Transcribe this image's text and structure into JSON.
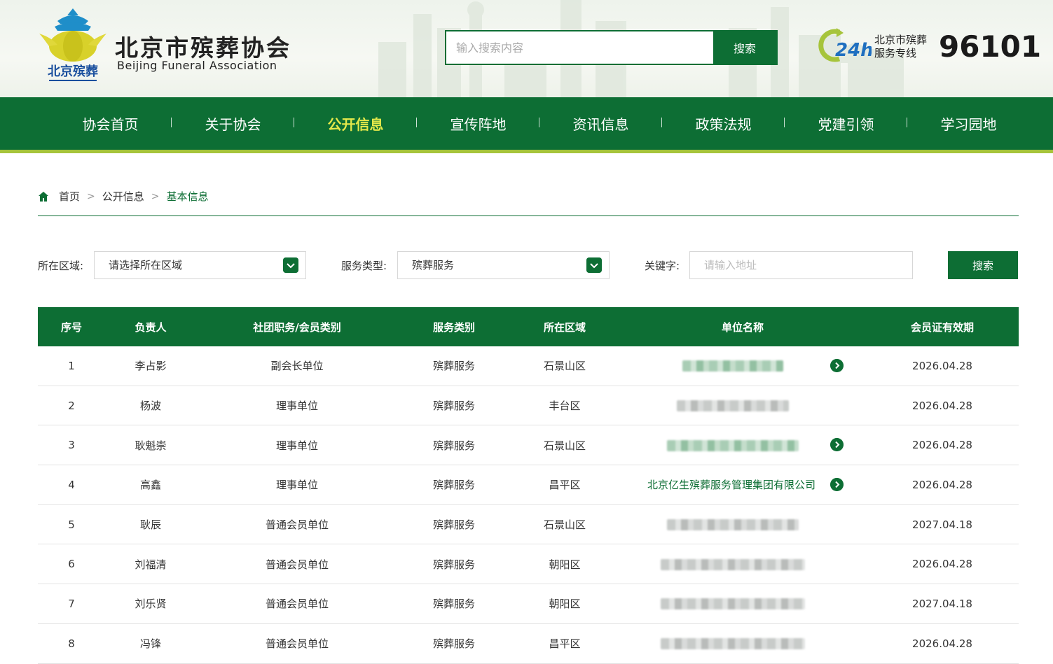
{
  "header": {
    "logo_cn": "北京市殡葬协会",
    "logo_en": "Beijing Funeral Association",
    "search": {
      "placeholder": "输入搜索内容",
      "button": "搜索"
    },
    "hotline": {
      "line1": "北京市殡葬",
      "line2": "服务专线",
      "number": "96101",
      "icon_text": "24h"
    }
  },
  "nav": {
    "items": [
      "协会首页",
      "关于协会",
      "公开信息",
      "宣传阵地",
      "资讯信息",
      "政策法规",
      "党建引领",
      "学习园地"
    ],
    "active_index": 2
  },
  "breadcrumb": {
    "home": "首页",
    "section": "公开信息",
    "current": "基本信息"
  },
  "filters": {
    "region_label": "所在区域:",
    "region_value": "请选择所在区域",
    "type_label": "服务类型:",
    "type_value": "殡葬服务",
    "keyword_label": "关键字:",
    "keyword_placeholder": "请输入地址",
    "button": "搜索"
  },
  "table": {
    "headers": [
      "序号",
      "负责人",
      "社团职务/会员类别",
      "服务类别",
      "所在区域",
      "单位名称",
      "会员证有效期"
    ],
    "rows": [
      {
        "no": "1",
        "person": "李占影",
        "role": "副会长单位",
        "service": "殡葬服务",
        "region": "石景山区",
        "unit": "",
        "expiry": "2026.04.28"
      },
      {
        "no": "2",
        "person": "杨波",
        "role": "理事单位",
        "service": "殡葬服务",
        "region": "丰台区",
        "unit": "",
        "expiry": "2026.04.28"
      },
      {
        "no": "3",
        "person": "耿魁崇",
        "role": "理事单位",
        "service": "殡葬服务",
        "region": "石景山区",
        "unit": "",
        "expiry": "2026.04.28"
      },
      {
        "no": "4",
        "person": "高鑫",
        "role": "理事单位",
        "service": "殡葬服务",
        "region": "昌平区",
        "unit": "北京亿生殡葬服务管理集团有限公司",
        "expiry": "2026.04.28"
      },
      {
        "no": "5",
        "person": "耿辰",
        "role": "普通会员单位",
        "service": "殡葬服务",
        "region": "石景山区",
        "unit": "",
        "expiry": "2027.04.18"
      },
      {
        "no": "6",
        "person": "刘福清",
        "role": "普通会员单位",
        "service": "殡葬服务",
        "region": "朝阳区",
        "unit": "",
        "expiry": "2026.04.28"
      },
      {
        "no": "7",
        "person": "刘乐贤",
        "role": "普通会员单位",
        "service": "殡葬服务",
        "region": "朝阳区",
        "unit": "",
        "expiry": "2027.04.18"
      },
      {
        "no": "8",
        "person": "冯锋",
        "role": "普通会员单位",
        "service": "殡葬服务",
        "region": "昌平区",
        "unit": "",
        "expiry": "2026.04.28"
      }
    ]
  },
  "colors": {
    "primary": "#0d6e34",
    "accent_line": "#a6c43b",
    "nav_active": "#e4e84a"
  }
}
